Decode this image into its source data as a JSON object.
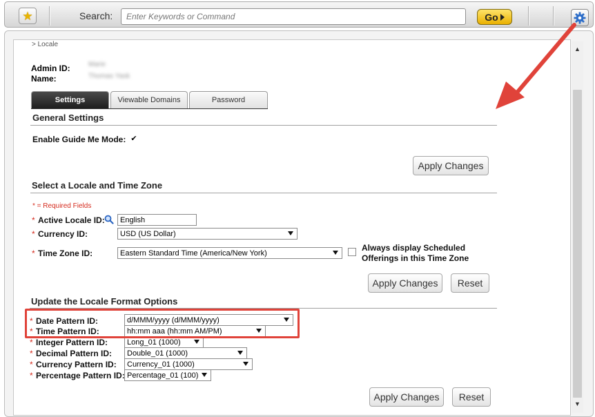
{
  "toolbar": {
    "search_label": "Search:",
    "search_placeholder": "Enter Keywords or Command",
    "go_label": "Go",
    "icons": {
      "favorites": "star-icon",
      "go": "play-triangle-icon",
      "settings": "gear-icon"
    }
  },
  "page": {
    "breadcrumb": "> Locale",
    "admin_id_label": "Admin ID:",
    "admin_id_value": "Marie",
    "name_label": "Name:",
    "name_value": "Thomas Yask"
  },
  "tabs": [
    {
      "label": "Settings",
      "active": true
    },
    {
      "label": "Viewable Domains",
      "active": false
    },
    {
      "label": "Password",
      "active": false
    }
  ],
  "general_settings": {
    "title": "General Settings",
    "guide_me_label": "Enable Guide Me Mode:",
    "guide_me_checked": true,
    "apply_label": "Apply Changes"
  },
  "locale_section": {
    "title": "Select a Locale and Time Zone",
    "required_note": "* = Required Fields",
    "required_marker": "*",
    "active_locale_label": "Active Locale ID:",
    "active_locale_value": "English",
    "currency_label": "Currency ID:",
    "currency_value": "USD (US Dollar)",
    "timezone_label": "Time Zone ID:",
    "timezone_value": "Eastern Standard Time (America/New York)",
    "always_display_label_line1": "Always display Scheduled",
    "always_display_label_line2": "Offerings in this Time Zone",
    "always_display_checked": false,
    "apply_label": "Apply Changes",
    "reset_label": "Reset"
  },
  "format_section": {
    "title": "Update the Locale Format Options",
    "date_label": "Date Pattern ID:",
    "date_value": "d/MMM/yyyy (d/MMM/yyyy)",
    "time_label": "Time Pattern ID:",
    "time_value": "hh:mm aaa (hh:mm AM/PM)",
    "integer_label": "Integer Pattern ID:",
    "integer_value": "Long_01 (1000)",
    "decimal_label": "Decimal Pattern ID:",
    "decimal_value": "Double_01 (1000)",
    "currency_label": "Currency Pattern ID:",
    "currency_value": "Currency_01 (1000)",
    "percentage_label": "Percentage Pattern ID:",
    "percentage_value": "Percentage_01 (100)",
    "apply_label": "Apply Changes",
    "reset_label": "Reset"
  },
  "colors": {
    "highlight": "#e0433a",
    "required": "#d52b1e",
    "go_button": "#f2c21a"
  }
}
